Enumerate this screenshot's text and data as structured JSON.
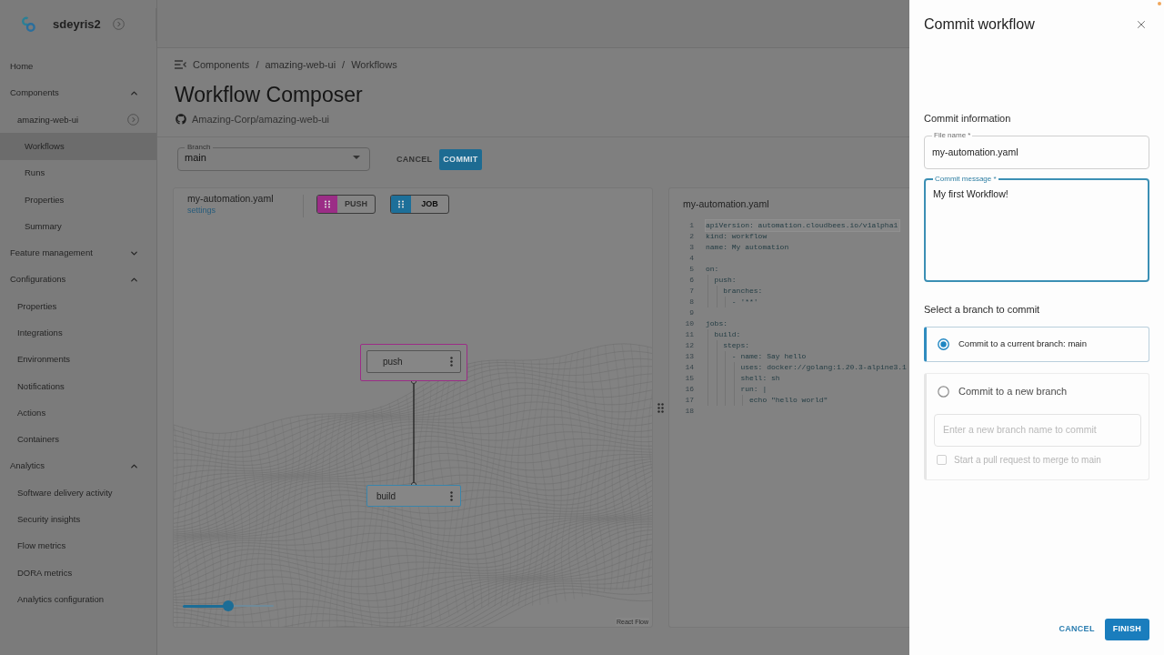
{
  "sidebar": {
    "workspace": "sdeyris2",
    "items": [
      {
        "label": "Home",
        "kind": "page",
        "selected": false
      },
      {
        "label": "Components",
        "kind": "group",
        "expanded": true,
        "selected": false,
        "children": [
          {
            "label": "amazing-web-ui",
            "kind": "component",
            "selected": false,
            "children": [
              {
                "label": "Workflows",
                "kind": "page",
                "selected": true
              },
              {
                "label": "Runs",
                "kind": "page",
                "selected": false
              },
              {
                "label": "Properties",
                "kind": "page",
                "selected": false
              },
              {
                "label": "Summary",
                "kind": "page",
                "selected": false
              }
            ]
          }
        ]
      },
      {
        "label": "Feature management",
        "kind": "group",
        "expanded": false,
        "selected": false
      },
      {
        "label": "Configurations",
        "kind": "group",
        "expanded": true,
        "selected": false,
        "children": [
          {
            "label": "Properties",
            "kind": "page",
            "selected": false
          },
          {
            "label": "Integrations",
            "kind": "page",
            "selected": false
          },
          {
            "label": "Environments",
            "kind": "page",
            "selected": false
          },
          {
            "label": "Notifications",
            "kind": "page",
            "selected": false
          },
          {
            "label": "Actions",
            "kind": "page",
            "selected": false
          },
          {
            "label": "Containers",
            "kind": "page",
            "selected": false
          }
        ]
      },
      {
        "label": "Analytics",
        "kind": "group",
        "expanded": true,
        "selected": false,
        "children": [
          {
            "label": "Software delivery activity",
            "kind": "page",
            "selected": false
          },
          {
            "label": "Security insights",
            "kind": "page",
            "selected": false
          },
          {
            "label": "Flow metrics",
            "kind": "page",
            "selected": false
          },
          {
            "label": "DORA metrics",
            "kind": "page",
            "selected": false
          },
          {
            "label": "Analytics configuration",
            "kind": "page",
            "selected": false
          }
        ]
      }
    ]
  },
  "breadcrumb": {
    "items": [
      "Components",
      "amazing-web-ui",
      "Workflows"
    ],
    "separator": "/"
  },
  "page": {
    "title": "Workflow Composer",
    "repository": "Amazing-Corp/amazing-web-ui"
  },
  "toolbar": {
    "branch": {
      "label": "Branch",
      "value": "main"
    },
    "buttons": [
      {
        "label": "CANCEL",
        "kind": "text",
        "disabled": true
      },
      {
        "label": "COMMIT",
        "kind": "contained",
        "disabled": false
      }
    ]
  },
  "canvas": {
    "file_name": "my-automation.yaml",
    "settings_link": "settings",
    "palette": [
      {
        "label": "PUSH",
        "color": "#9b2d86",
        "disabled": true
      },
      {
        "label": "JOB",
        "color": "#1d6f99",
        "disabled": false
      }
    ],
    "nodes": [
      {
        "label": "push",
        "kind": "trigger",
        "color": "#9b2d86"
      },
      {
        "label": "build",
        "kind": "job",
        "color": "#3a85ab"
      }
    ],
    "zoom": {
      "level": 0.5
    },
    "attribution": "React Flow"
  },
  "code": {
    "title": "my-automation.yaml",
    "lines": [
      {
        "number": "1",
        "text": "apiVersion: automation.cloudbees.io/v1alpha1",
        "active": true
      },
      {
        "number": "2",
        "text": "kind: workflow",
        "active": false
      },
      {
        "number": "3",
        "text": "name: My automation",
        "active": false
      },
      {
        "number": "4",
        "active": false
      },
      {
        "number": "5",
        "text": "on:",
        "active": false
      },
      {
        "number": "6",
        "text": "  push:",
        "active": false
      },
      {
        "number": "7",
        "text": "    branches:",
        "active": false
      },
      {
        "number": "8",
        "text": "      - '**'",
        "active": false
      },
      {
        "number": "9",
        "active": false
      },
      {
        "number": "10",
        "text": "jobs:",
        "active": false
      },
      {
        "number": "11",
        "text": "  build:",
        "active": false
      },
      {
        "number": "12",
        "text": "    steps:",
        "active": false
      },
      {
        "number": "13",
        "text": "      - name: Say hello",
        "active": false
      },
      {
        "number": "14",
        "text": "        uses: docker://golang:1.20.3-alpine3.1",
        "active": false
      },
      {
        "number": "15",
        "text": "        shell: sh",
        "active": false
      },
      {
        "number": "16",
        "text": "        run: |",
        "active": false
      },
      {
        "number": "17",
        "text": "          echo \"hello world\"",
        "active": false
      },
      {
        "number": "18",
        "active": false
      }
    ]
  },
  "drawer": {
    "title": "Commit workflow",
    "info_title": "Commit information",
    "fields": [
      {
        "kind": "single",
        "label": "File name *",
        "value": "my-automation.yaml",
        "focused": false
      },
      {
        "kind": "multiline",
        "label": "Commit message *",
        "value": "My first Workflow!",
        "focused": true
      }
    ],
    "branch_title": "Select a branch to commit",
    "options": [
      {
        "label": "Commit to a current branch: main",
        "selected": true
      },
      {
        "label": "Commit to a new branch",
        "selected": false,
        "branch_name": {
          "placeholder": "Enter a new branch name to commit",
          "disabled": true
        },
        "pull_request": {
          "label": "Start a pull request to merge to main",
          "checked": false,
          "disabled": true
        }
      }
    ],
    "buttons": [
      {
        "label": "CANCEL",
        "kind": "text"
      },
      {
        "label": "FINISH",
        "kind": "contained"
      }
    ]
  }
}
